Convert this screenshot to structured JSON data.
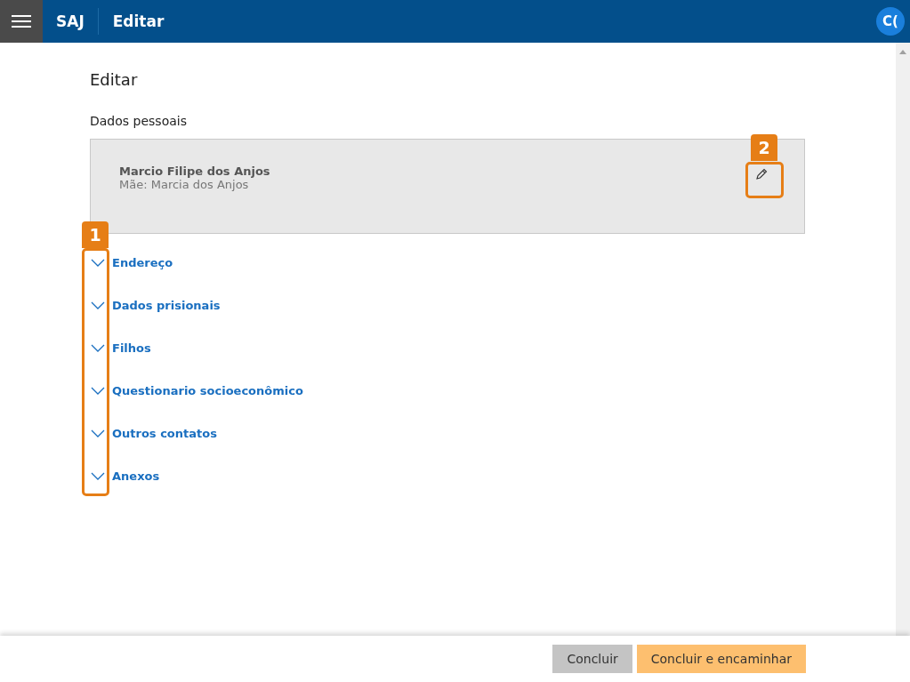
{
  "header": {
    "app": "SAJ",
    "title": "Editar",
    "avatar": "C("
  },
  "page": {
    "title": "Editar",
    "section": "Dados pessoais"
  },
  "person": {
    "name": "Marcio Filipe dos Anjos",
    "mother": "Mãe: Marcia dos Anjos"
  },
  "sections": [
    {
      "label": "Endereço",
      "expanded": false
    },
    {
      "label": "Dados prisionais",
      "expanded": false
    },
    {
      "label": "Filhos",
      "expanded": false
    },
    {
      "label": "Questionario socioeconômico",
      "expanded": false
    },
    {
      "label": "Outros contatos",
      "expanded": false
    },
    {
      "label": "Anexos",
      "expanded": false
    }
  ],
  "callouts": [
    {
      "number": "1"
    },
    {
      "number": "2"
    }
  ],
  "buttons": [
    {
      "label": "Concluir",
      "kind": "secondary"
    },
    {
      "label": "Concluir e encaminhar",
      "kind": "primary"
    }
  ]
}
